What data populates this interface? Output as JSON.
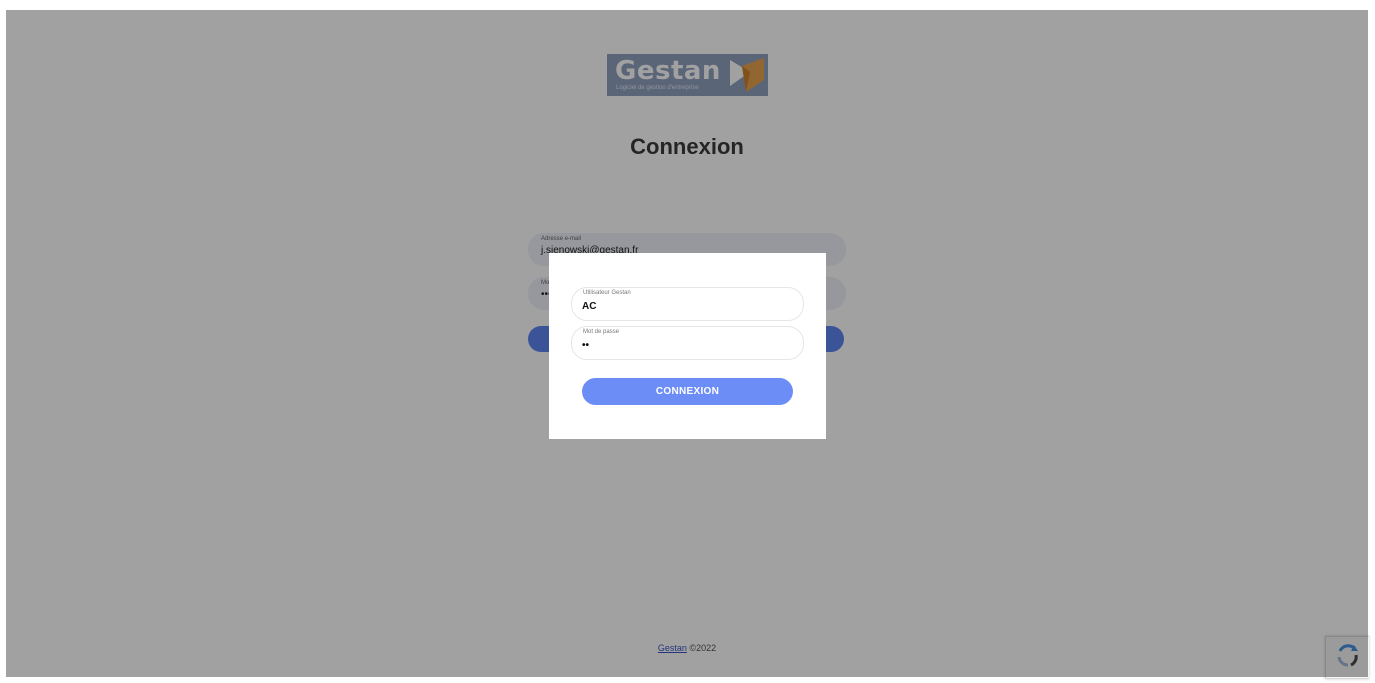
{
  "logo": {
    "word": "Gestan",
    "tagline": "Logiciel de gestion d'entreprise"
  },
  "page_title": "Connexion",
  "background_form": {
    "email_label": "Adresse e-mail",
    "email_value": "j.sienowski@gestan.fr",
    "password_label": "Mot de passe",
    "password_value": "••••••••"
  },
  "footer": {
    "link": "Gestan",
    "text": "©2022"
  },
  "modal": {
    "user_label": "Utilisateur Gestan",
    "user_value": "AC",
    "password_label": "Mot de passe",
    "password_value": "••",
    "submit_label": "CONNEXION"
  },
  "colors": {
    "accent": "#6b8df5",
    "overlay": "rgba(0,0,0,0.37)",
    "logo_orange": "#e8a24c"
  }
}
